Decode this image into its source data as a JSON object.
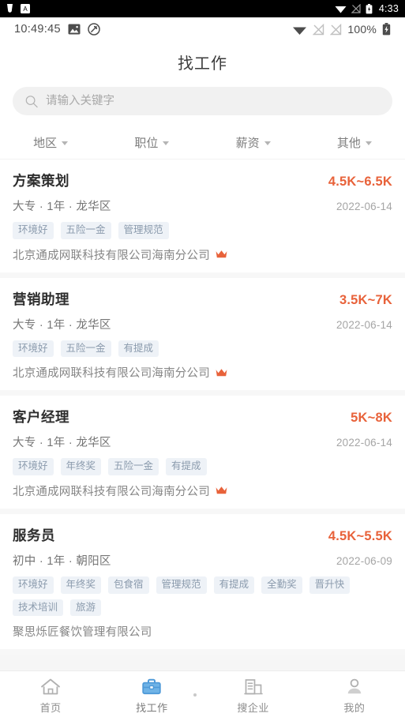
{
  "system_bar": {
    "time": "4:33",
    "left_icons": [
      "notification-icon",
      "app-badge-icon"
    ],
    "right_icons": [
      "wifi-icon",
      "signal-icon",
      "battery-charging-icon"
    ]
  },
  "app_status_bar": {
    "clock": "10:49:45",
    "left_icons": [
      "image-icon",
      "screen-record-icon"
    ],
    "right_icons": [
      "wifi-icon",
      "sim1-no-signal-icon",
      "sim2-no-signal-icon"
    ],
    "battery_percent": "100%",
    "battery_icon": "battery-charging-icon"
  },
  "header": {
    "title": "找工作"
  },
  "search": {
    "icon": "search-icon",
    "placeholder": "请输入关键字",
    "value": ""
  },
  "filters": [
    {
      "label": "地区",
      "icon": "chevron-down-icon"
    },
    {
      "label": "职位",
      "icon": "chevron-down-icon"
    },
    {
      "label": "薪资",
      "icon": "chevron-down-icon"
    },
    {
      "label": "其他",
      "icon": "chevron-down-icon"
    }
  ],
  "colors": {
    "salary": "#e8623a",
    "tag_bg": "#eef2f7",
    "tag_text": "#8b9bad",
    "active_tab": "#4f9ad8",
    "crown": "#e8623a"
  },
  "jobs": [
    {
      "title": "方案策划",
      "salary": "4.5K~6.5K",
      "meta": "大专 · 1年 · 龙华区",
      "date": "2022-06-14",
      "tags": [
        "环境好",
        "五险一金",
        "管理规范"
      ],
      "company": "北京通成网联科技有限公司海南分公司",
      "badge": "crown-icon"
    },
    {
      "title": "营销助理",
      "salary": "3.5K~7K",
      "meta": "大专 · 1年 · 龙华区",
      "date": "2022-06-14",
      "tags": [
        "环境好",
        "五险一金",
        "有提成"
      ],
      "company": "北京通成网联科技有限公司海南分公司",
      "badge": "crown-icon"
    },
    {
      "title": "客户经理",
      "salary": "5K~8K",
      "meta": "大专 · 1年 · 龙华区",
      "date": "2022-06-14",
      "tags": [
        "环境好",
        "年终奖",
        "五险一金",
        "有提成"
      ],
      "company": "北京通成网联科技有限公司海南分公司",
      "badge": "crown-icon"
    },
    {
      "title": "服务员",
      "salary": "4.5K~5.5K",
      "meta": "初中 · 1年 · 朝阳区",
      "date": "2022-06-09",
      "tags": [
        "环境好",
        "年终奖",
        "包食宿",
        "管理规范",
        "有提成",
        "全勤奖",
        "晋升快",
        "技术培训",
        "旅游"
      ],
      "company": "聚思烁匠餐饮管理有限公司",
      "badge": ""
    }
  ],
  "tabbar": [
    {
      "label": "首页",
      "icon": "home-icon",
      "active": false
    },
    {
      "label": "找工作",
      "icon": "briefcase-icon",
      "active": true
    },
    {
      "label": "搜企业",
      "icon": "building-icon",
      "active": false
    },
    {
      "label": "我的",
      "icon": "person-icon",
      "active": false
    }
  ]
}
